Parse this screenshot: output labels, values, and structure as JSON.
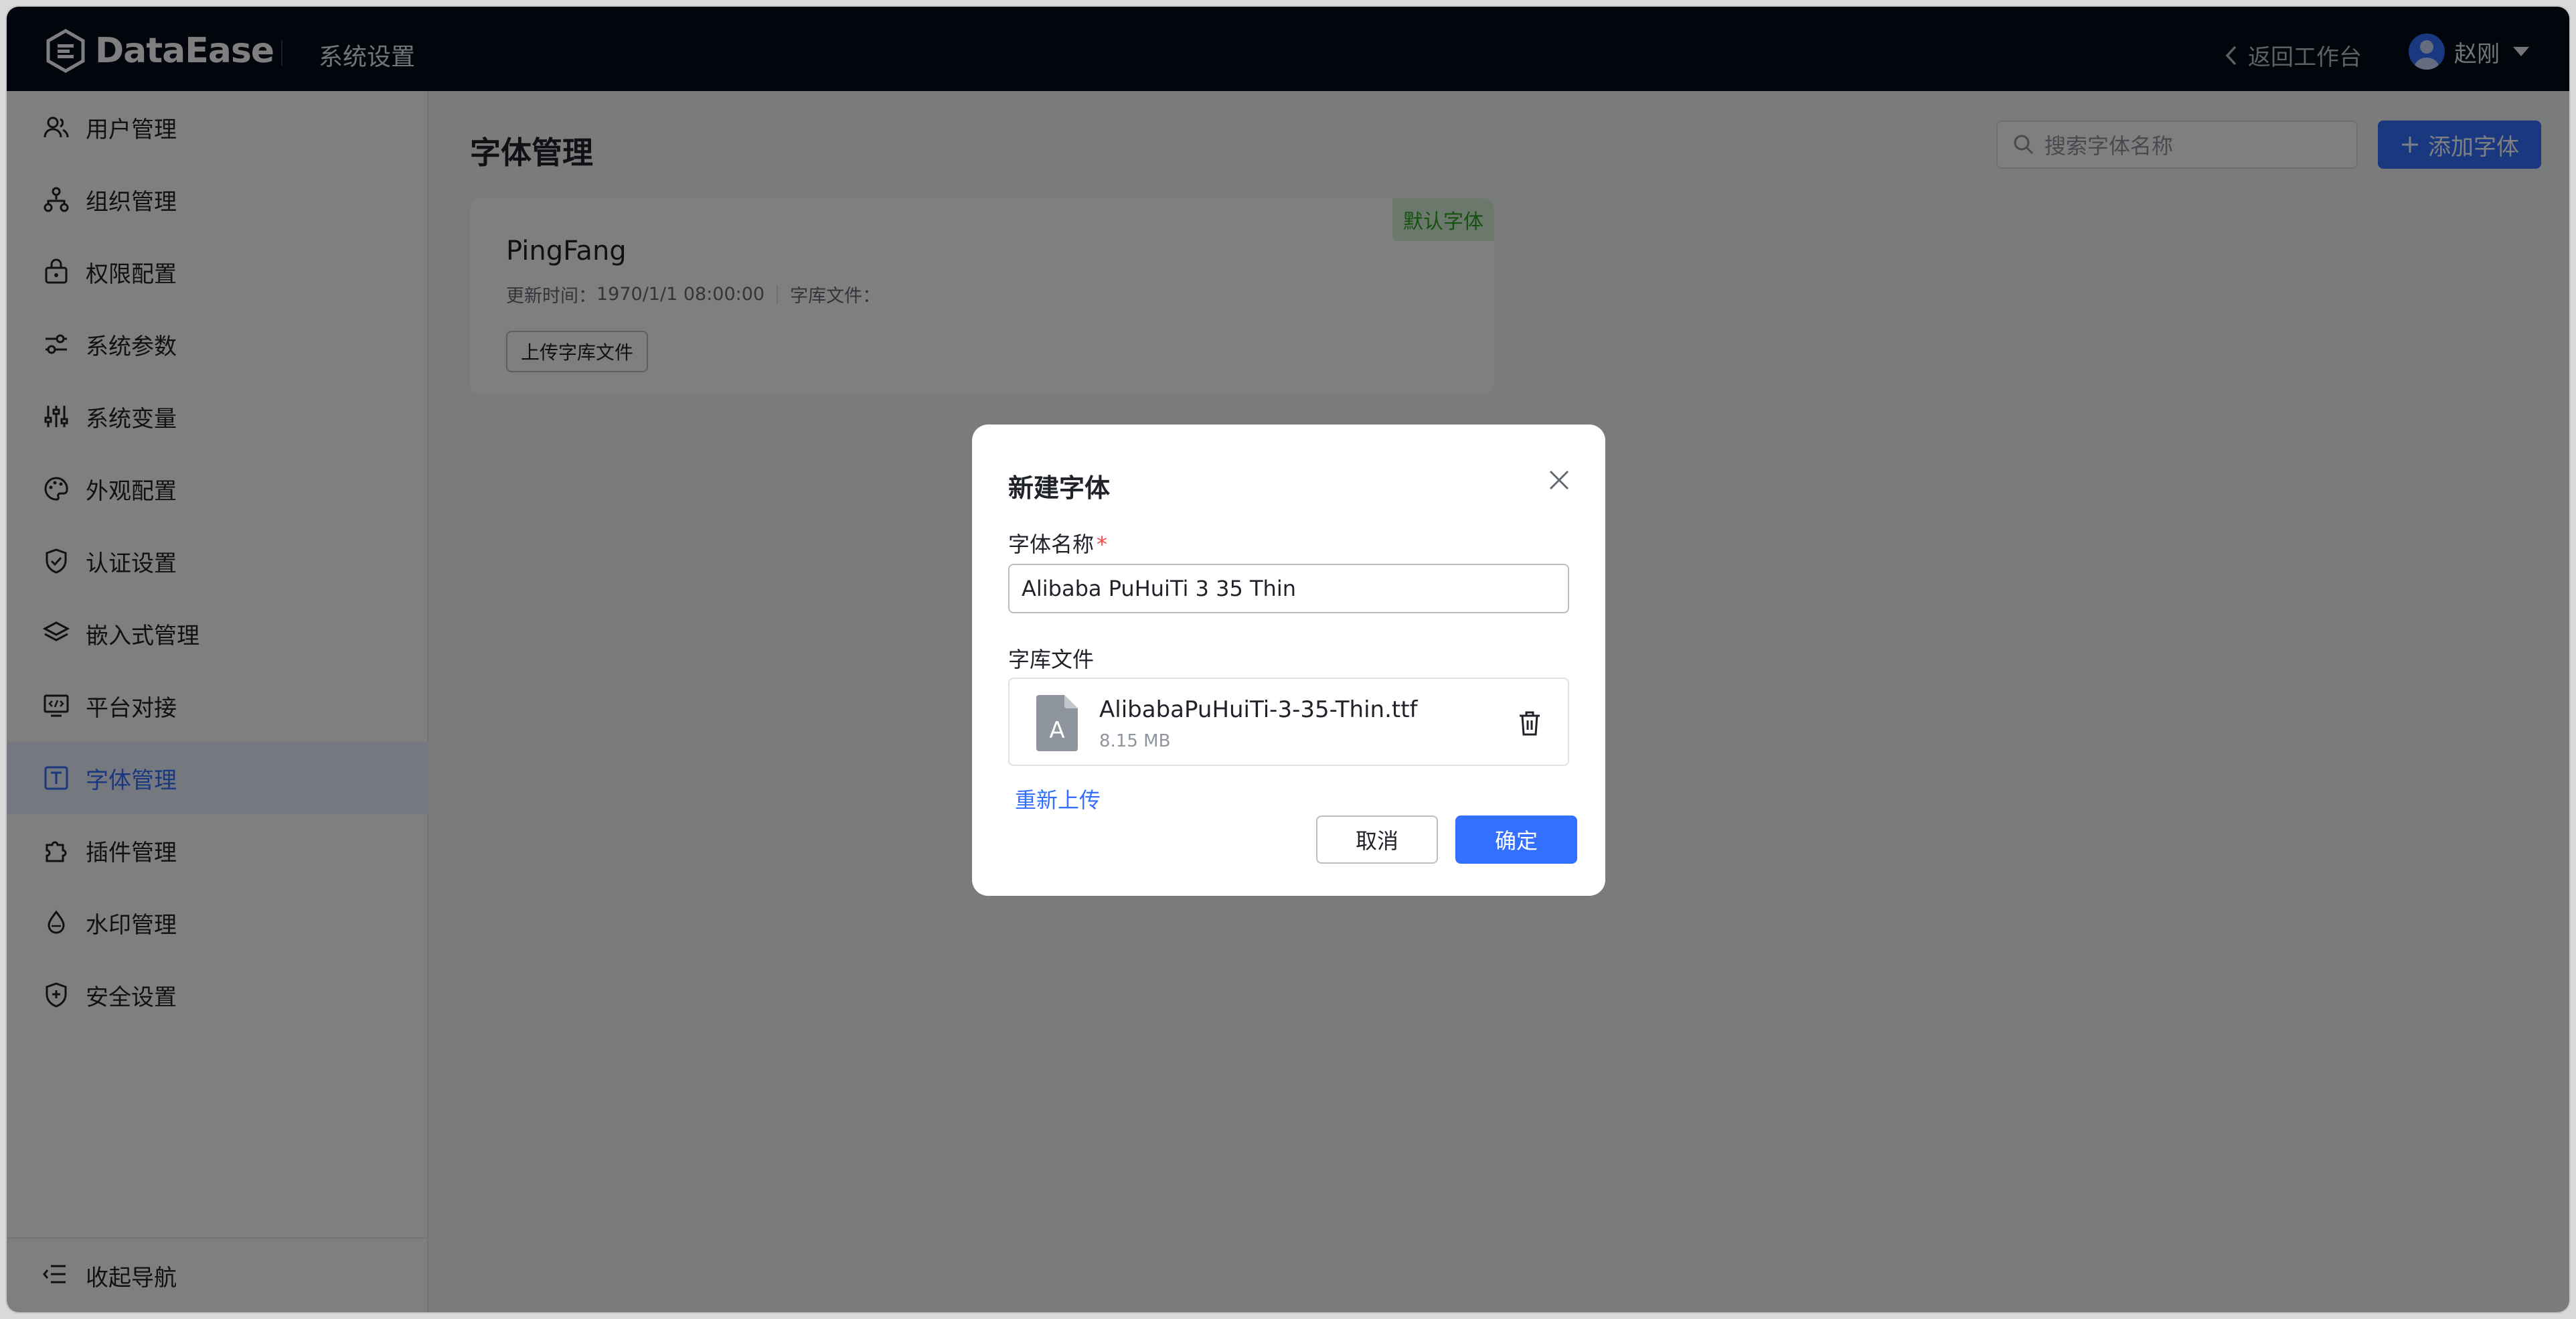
{
  "header": {
    "logo_text": "DataEase",
    "title": "系统设置",
    "back_label": "返回工作台",
    "user_name": "赵刚"
  },
  "sidebar": {
    "items": [
      {
        "label": "用户管理",
        "icon": "users-icon"
      },
      {
        "label": "组织管理",
        "icon": "org-tree-icon"
      },
      {
        "label": "权限配置",
        "icon": "lock-icon"
      },
      {
        "label": "系统参数",
        "icon": "sliders-icon"
      },
      {
        "label": "系统变量",
        "icon": "variable-sliders-icon"
      },
      {
        "label": "外观配置",
        "icon": "palette-icon"
      },
      {
        "label": "认证设置",
        "icon": "shield-check-icon"
      },
      {
        "label": "嵌入式管理",
        "icon": "layers-icon"
      },
      {
        "label": "平台对接",
        "icon": "monitor-code-icon"
      },
      {
        "label": "字体管理",
        "icon": "font-icon",
        "active": true
      },
      {
        "label": "插件管理",
        "icon": "puzzle-icon"
      },
      {
        "label": "水印管理",
        "icon": "drop-icon"
      },
      {
        "label": "安全设置",
        "icon": "shield-plus-icon"
      }
    ],
    "collapse_label": "收起导航"
  },
  "main": {
    "page_title": "字体管理",
    "search_placeholder": "搜索字体名称",
    "add_button": "添加字体",
    "card": {
      "badge": "默认字体",
      "name": "PingFang",
      "update_label": "更新时间：",
      "update_time": "1970/1/1 08:00:00",
      "file_label": "字库文件：",
      "upload_button": "上传字库文件"
    }
  },
  "dialog": {
    "title": "新建字体",
    "name_label": "字体名称",
    "required_mark": "*",
    "name_value": "Alibaba PuHuiTi 3 35 Thin",
    "file_label": "字库文件",
    "file_name": "AlibabaPuHuiTi-3-35-Thin.ttf",
    "file_size": "8.15 MB",
    "file_icon_letter": "A",
    "reupload": "重新上传",
    "cancel": "取消",
    "confirm": "确定"
  },
  "colors": {
    "accent": "#3370ff",
    "header_bg": "#050c18",
    "badge_bg": "#d6f2d9",
    "badge_text": "#2ea121"
  }
}
